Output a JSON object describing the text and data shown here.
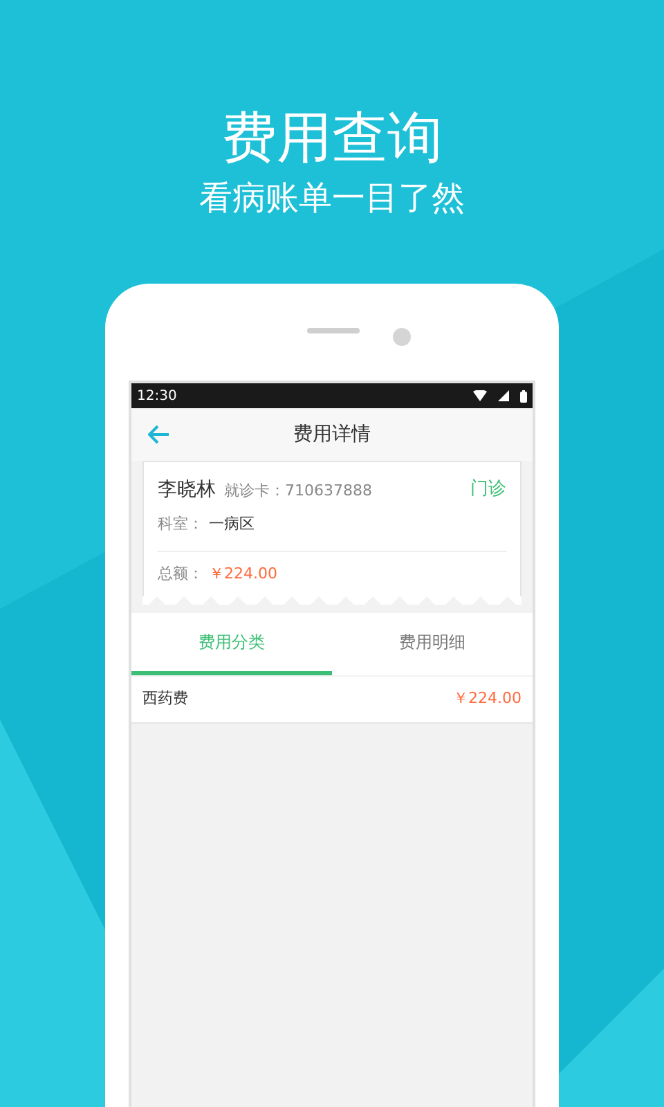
{
  "promo": {
    "title": "费用查询",
    "subtitle": "看病账单一目了然"
  },
  "status_bar": {
    "time": "12:30"
  },
  "app_bar": {
    "title": "费用详情"
  },
  "patient_card": {
    "name": "李晓林",
    "card_label": "就诊卡：",
    "card_number": "710637888",
    "visit_type": "门诊",
    "department_label": "科室：",
    "department": "一病区",
    "total_label": "总额：",
    "total": "￥224.00"
  },
  "tabs": [
    {
      "label": "费用分类",
      "selected": true
    },
    {
      "label": "费用明细",
      "selected": false
    }
  ],
  "fee_rows": [
    {
      "name": "西药费",
      "amount": "￥224.00"
    }
  ]
}
